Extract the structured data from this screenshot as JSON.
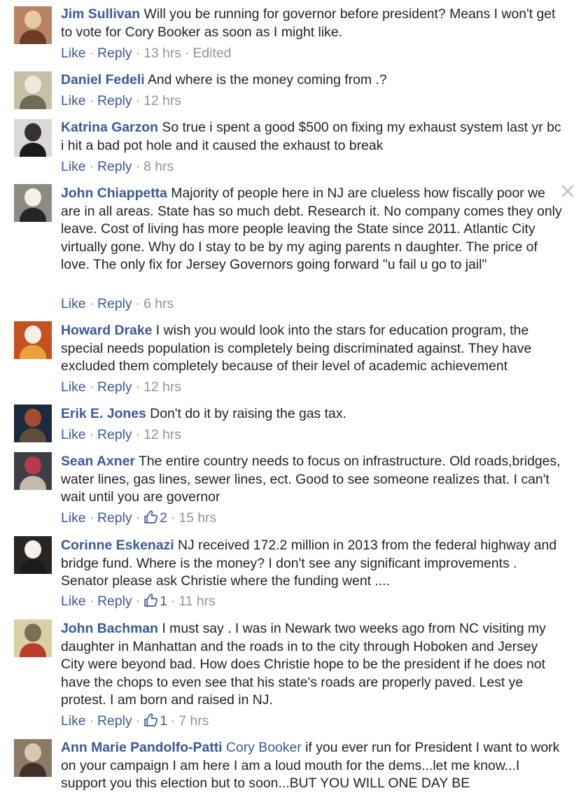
{
  "ui": {
    "like_label": "Like",
    "reply_label": "Reply",
    "separator": "·",
    "accent_color": "#3b5998",
    "meta_color": "#90949c"
  },
  "comments": [
    {
      "author": "Jim Sullivan",
      "mention": "",
      "text": "Will you be running for governor before president? Means I won't get to vote for Cory Booker as soon as I might like.",
      "likes": "",
      "time": "13 hrs",
      "edited": "Edited"
    },
    {
      "author": "Daniel Fedeli",
      "mention": "",
      "text": "And where is the money coming from .?",
      "likes": "",
      "time": "12 hrs",
      "edited": ""
    },
    {
      "author": "Katrina Garzon",
      "mention": "",
      "text": "So true i spent a good $500 on fixing my exhaust system last yr bc i hit a bad pot hole and it caused the exhaust to break",
      "likes": "",
      "time": "8 hrs",
      "edited": ""
    },
    {
      "author": "John Chiappetta",
      "mention": "",
      "text": "Majority of people here in NJ are clueless how fiscally poor we are in all areas. State has so much debt. Research it. No company comes they only leave. Cost of living has more people leaving the State since 2011. Atlantic City virtually gone. Why do I stay to be by my aging parents n daughter. The price of love. The only fix for Jersey Governors going forward \"u fail u go to jail\"",
      "likes": "",
      "time": "6 hrs",
      "edited": ""
    },
    {
      "author": "Howard Drake",
      "mention": "",
      "text": "I wish you would look into the stars for education program, the special needs population is completely being discriminated against. They have excluded them completely because of their level of academic achievement",
      "likes": "",
      "time": "12 hrs",
      "edited": ""
    },
    {
      "author": "Erik E. Jones",
      "mention": "",
      "text": "Don't do it by raising the gas tax.",
      "likes": "",
      "time": "12 hrs",
      "edited": ""
    },
    {
      "author": "Sean Axner",
      "mention": "",
      "text": "The entire country needs to focus on infrastructure. Old roads,bridges, water lines, gas lines, sewer lines, ect. Good to see someone realizes that. I can't wait until you are governor",
      "likes": "2",
      "time": "15 hrs",
      "edited": ""
    },
    {
      "author": "Corinne Eskenazi",
      "mention": "",
      "text": "NJ received 172.2 million in 2013 from the federal highway and bridge fund. Where is the money? I don't see any significant improvements . Senator please ask Christie where the funding went ....",
      "likes": "1",
      "time": "11 hrs",
      "edited": ""
    },
    {
      "author": "John Bachman",
      "mention": "",
      "text": "I must say . I was in Newark two weeks ago from NC visiting my daughter in Manhattan and the roads in to the city through Hoboken and Jersey City were beyond bad. How does Christie hope to be the president if he does not have the chops to even see that his state's roads are properly paved. Lest ye protest. I am born and raised in NJ.",
      "likes": "1",
      "time": "7 hrs",
      "edited": ""
    },
    {
      "author": "Ann Marie Pandolfo-Patti",
      "mention": "Cory Booker",
      "text": "if you ever run for President I want to work on your campaign I am here I am a loud mouth for the dems...let me know...I support you this election but to soon...BUT YOU WILL ONE DAY BE",
      "likes": "",
      "time": "",
      "edited": ""
    }
  ],
  "icons": {
    "remove": "close-icon",
    "like": "thumbs-up-icon"
  }
}
